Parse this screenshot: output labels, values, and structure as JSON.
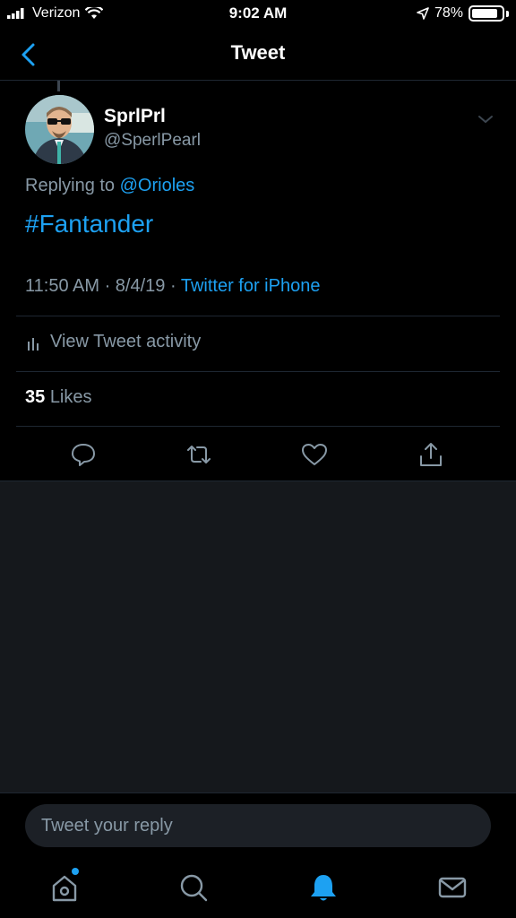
{
  "status_bar": {
    "carrier": "Verizon",
    "time": "9:02 AM",
    "battery": "78%"
  },
  "nav": {
    "title": "Tweet"
  },
  "tweet": {
    "display_name": "SprlPrl",
    "handle": "@SperlPearl",
    "replying_prefix": "Replying to",
    "replying_to": "@Orioles",
    "text": "#Fantander",
    "timestamp": "11:50 AM · 8/4/19 ·",
    "source": "Twitter for iPhone",
    "activity_label": "View Tweet activity",
    "likes_count": "35",
    "likes_label": "Likes"
  },
  "reply": {
    "placeholder": "Tweet your reply"
  },
  "colors": {
    "accent": "#1da1f2",
    "secondary_text": "#8899a6",
    "background": "#000000",
    "panel": "#15181c"
  },
  "icons": [
    "back-icon",
    "wifi-icon",
    "location-icon",
    "battery-icon",
    "chevron-down-icon",
    "bar-chart-icon",
    "reply-icon",
    "retweet-icon",
    "like-icon",
    "share-icon",
    "home-icon",
    "search-icon",
    "notifications-icon",
    "messages-icon"
  ]
}
